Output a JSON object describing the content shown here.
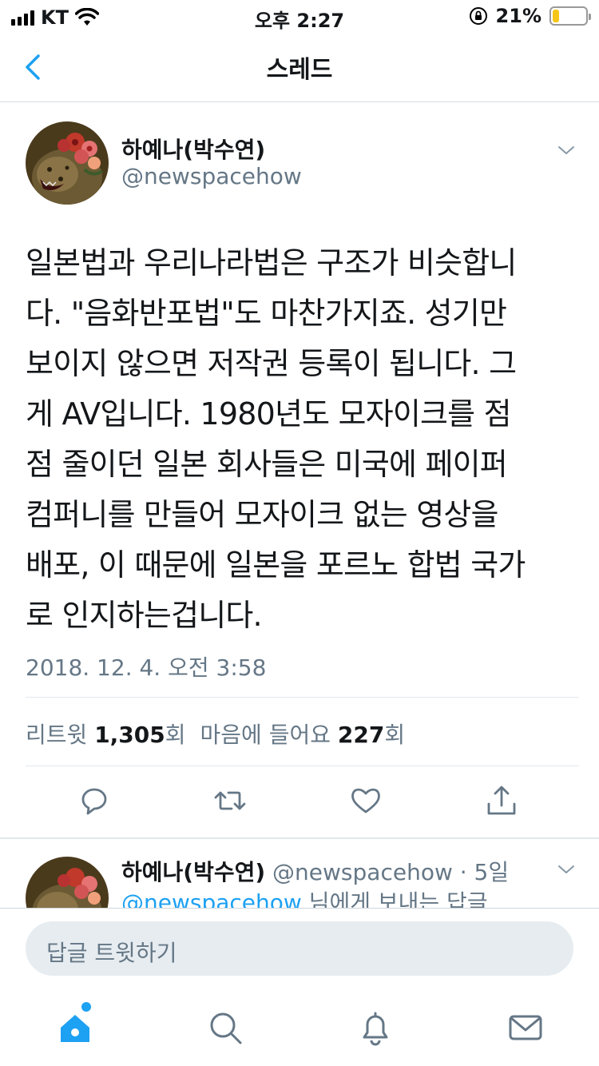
{
  "status_bar": {
    "carrier": "KT",
    "time": "오후 2:27",
    "battery_percent": "21%",
    "battery_level": 0.21,
    "battery_color": "#f5c518"
  },
  "header": {
    "title": "스레드",
    "back_icon": "chevron-left-icon"
  },
  "tweet": {
    "author_name": "하예나(박수연)",
    "author_handle": "@newspacehow",
    "text": "일본법과 우리나라법은 구조가 비슷합니\n다. \"음화반포법\"도 마찬가지죠. 성기만\n보이지 않으면 저작권 등록이 됩니다. 그\n게 AV입니다. 1980년도 모자이크를 점\n점 줄이던 일본 회사들은 미국에 페이퍼\n컴퍼니를 만들어 모자이크 없는 영상을\n배포, 이 때문에 일본을 포르노 합법 국가\n로 인지하는겁니다.",
    "timestamp": "2018. 12. 4. 오전 3:58",
    "retweet_label": "리트윗",
    "retweet_count": "1,305",
    "retweet_suffix": "회",
    "like_label": "마음에 들어요",
    "like_count": "227",
    "like_suffix": "회"
  },
  "actions": [
    "reply-icon",
    "retweet-icon",
    "like-icon",
    "share-icon"
  ],
  "reply_preview": {
    "author_name": "하예나(박수연)",
    "meta": " @newspacehow · 5일",
    "reply_mention": "@newspacehow",
    "reply_suffix": " 님에게 보내는 답글"
  },
  "compose": {
    "placeholder": "답글 트윗하기"
  },
  "tabbar": [
    "home-icon",
    "search-icon",
    "notifications-icon",
    "messages-icon"
  ],
  "colors": {
    "accent": "#1da1f2",
    "secondary_text": "#657786",
    "primary_text": "#14171a"
  }
}
